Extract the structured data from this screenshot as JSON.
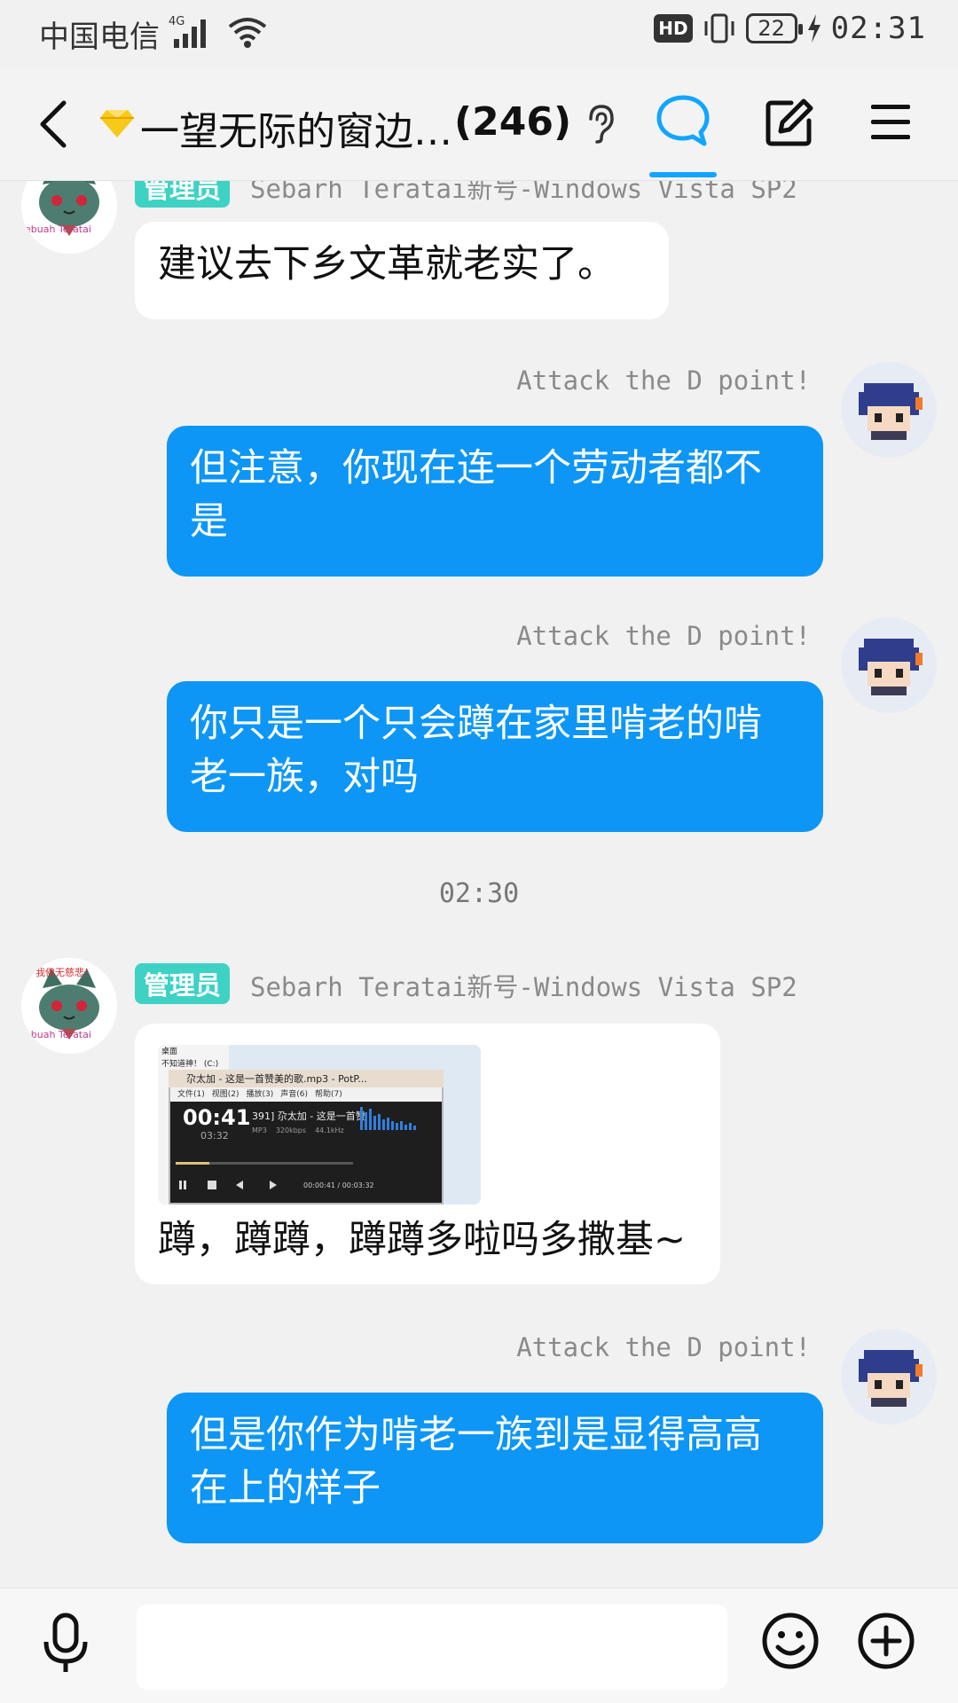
{
  "status_bar": {
    "carrier": "中国电信",
    "network": "4G",
    "hd": "HD",
    "battery": "22",
    "time": "02:31"
  },
  "header": {
    "title": "一望无际的窗边…",
    "count": "(246)"
  },
  "messages": [
    {
      "side": "in",
      "admin_badge": "管理员",
      "sender": "Sebarh Teratai新号-Windows Vista SP2",
      "text": "建议去下乡文革就老实了。"
    },
    {
      "side": "out",
      "sender": "Attack the D point!",
      "text_line1": "但注意，你现在连一个劳动者都不",
      "text_line2": "是"
    },
    {
      "side": "out",
      "sender": "Attack the D point!",
      "text_line1": "你只是一个只会蹲在家里啃老的啃",
      "text_line2": "老一族，对吗"
    },
    {
      "timestamp": "02:30"
    },
    {
      "side": "in",
      "admin_badge": "管理员",
      "sender": "Sebarh Teratai新号-Windows Vista SP2",
      "image": {
        "window_title": "尕太加 - 这是一首赞美的歌.mp3 - PotP...",
        "menu": [
          "文件(1)",
          "视图(2)",
          "播放(3)",
          "声音(6)",
          "帮助(7)"
        ],
        "time": "00:41",
        "sub_time": "03:32",
        "track": "391] 尕太加 - 这是一首赞",
        "format": "MP3",
        "bitrate": "320kbps",
        "rate": "44.1kHz",
        "progress": "00:00:41 / 00:03:32",
        "side_text1": "桌面",
        "side_text2": "不知道神！ (C:)",
        "progress_fraction": 0.19
      },
      "text": "蹲，蹲蹲，蹲蹲多啦吗多撒基~"
    },
    {
      "side": "out",
      "sender": "Attack the D point!",
      "text_line1": "但是你作为啃老一族到是显得高高",
      "text_line2": "在上的样子"
    }
  ],
  "avatars": {
    "admin_caption_top": "我佛无慈悲！",
    "admin_caption_bottom": "ebuah Teratai"
  },
  "input": {
    "placeholder": ""
  },
  "colors": {
    "accent": "#0d96f6",
    "admin_badge": "#3dd2c4",
    "active_tab": "#12a5ff"
  }
}
